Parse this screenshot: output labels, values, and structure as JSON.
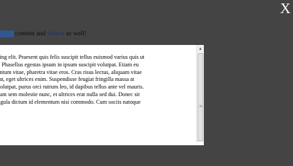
{
  "close_label": "X",
  "caption": {
    "highlighted_text": "more",
    "text_1": " content and ",
    "link": "videos",
    "text_2": " as well!"
  },
  "modal": {
    "lines": [
      "cing elit. Praesent quis felis suscipit tellus euismod varius quis ut",
      "i. Phasellus egestas ipsum in ipsum suscipit volutpat. Etiam eu",
      "entum vitae, pharetra vitae eros. Cras risus lectus, aliquam vitae",
      "rat, eget ultrices enim. Suspendisse feugiat fringilla massa at",
      "volutpat, purus orci rutrum leo, id dapibus tellus ante vel mauris.",
      "sum sem molestie nunc, et ultrices erat nulla sed dui. Donec sit",
      "ligula dictum id elementum nisi commodo. Cum sociis natoque"
    ]
  },
  "scrollbar": {
    "up_arrow": "▲",
    "grip": "≡"
  }
}
